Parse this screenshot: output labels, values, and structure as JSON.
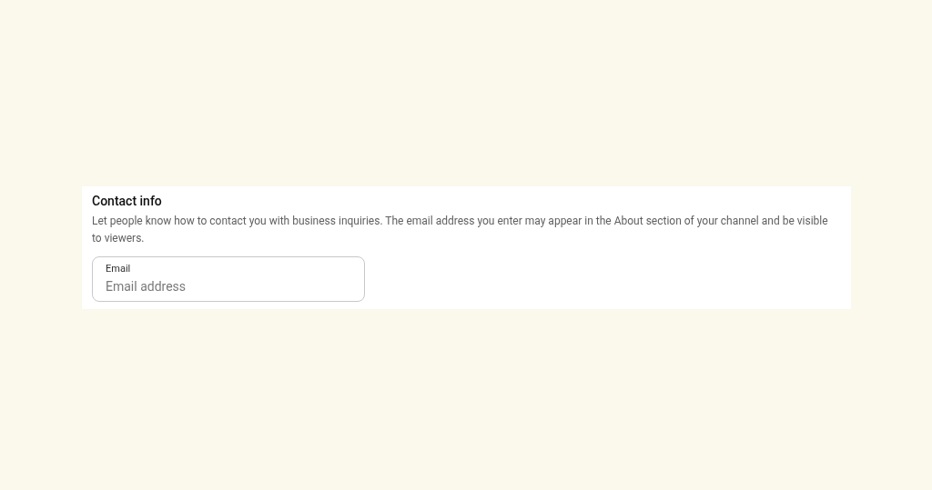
{
  "section": {
    "title": "Contact info",
    "description": "Let people know how to contact you with business inquiries. The email address you enter may appear in the About section of your channel and be visible to viewers."
  },
  "email_field": {
    "label": "Email",
    "placeholder": "Email address"
  }
}
